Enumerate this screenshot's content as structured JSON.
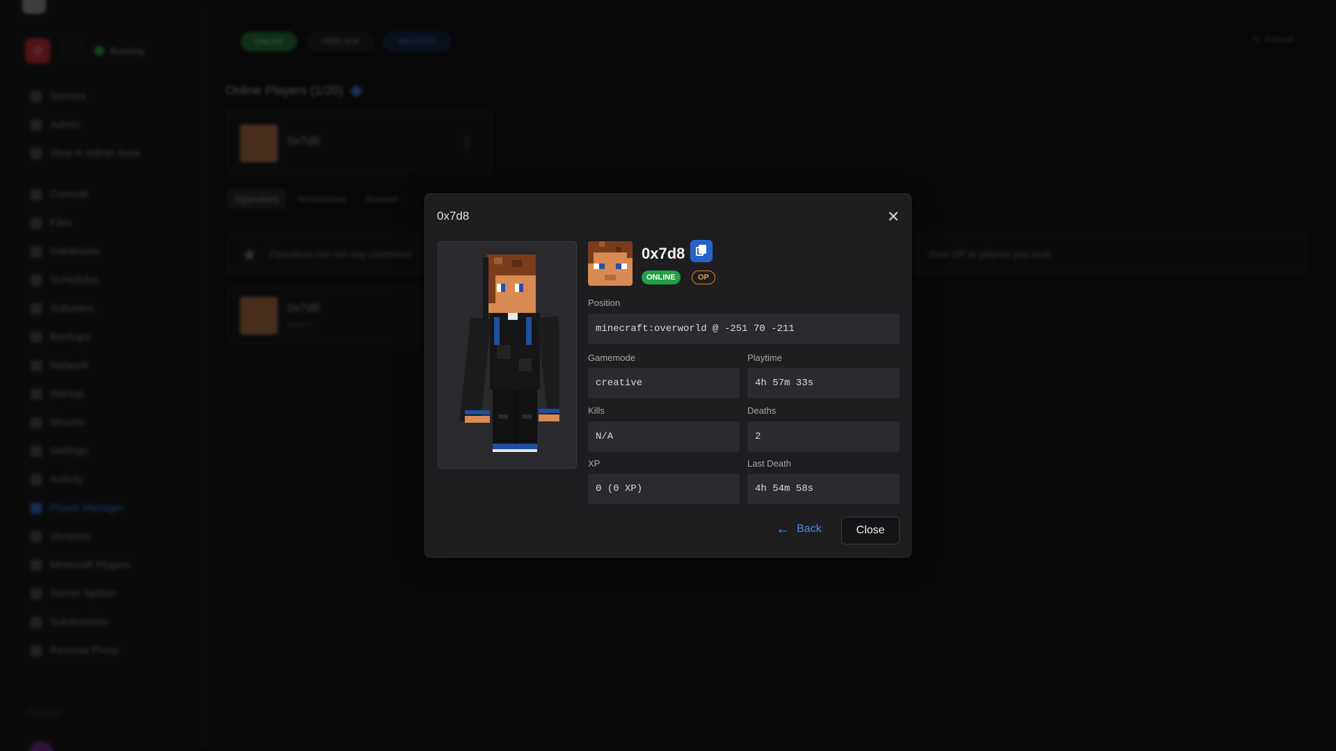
{
  "background": {
    "sidebar": {
      "running_label": "Running",
      "nav": [
        {
          "label": "Servers"
        },
        {
          "label": "Admin"
        },
        {
          "label": "View in Admin Area"
        },
        {
          "label": "Console"
        },
        {
          "label": "Files"
        },
        {
          "label": "Databases"
        },
        {
          "label": "Schedules"
        },
        {
          "label": "Subusers"
        },
        {
          "label": "Backups"
        },
        {
          "label": "Network"
        },
        {
          "label": "Startup"
        },
        {
          "label": "Mounts"
        },
        {
          "label": "Settings"
        },
        {
          "label": "Activity"
        },
        {
          "label": "Player Manager"
        },
        {
          "label": "Versions"
        },
        {
          "label": "Minecraft Plugins"
        },
        {
          "label": "Server Splitter"
        },
        {
          "label": "Subdomains"
        },
        {
          "label": "Reverse Proxy"
        }
      ],
      "footer_label": "Personal"
    },
    "status": {
      "online": "ONLINE",
      "free": "FREE 3GB",
      "version": "VELOCITY"
    },
    "reboot_label": "Reboot",
    "online_players_title": "Online Players (1/20)",
    "player_card_name": "0x7d8",
    "tabs": [
      "Operators",
      "Whitelisted",
      "Banned"
    ],
    "info_left": "Operators can run any command",
    "info_right": "Give OP to players you trust.",
    "op_player_name": "0x7d8",
    "op_player_sub": "Level 4"
  },
  "dialog": {
    "title": "0x7d8",
    "player_name": "0x7d8",
    "badges": {
      "online": "ONLINE",
      "op": "OP"
    },
    "position": {
      "label": "Position",
      "value": "minecraft:overworld @ -251 70 -211"
    },
    "gamemode": {
      "label": "Gamemode",
      "value": "creative"
    },
    "playtime": {
      "label": "Playtime",
      "value": "4h 57m 33s"
    },
    "kills": {
      "label": "Kills",
      "value": "N/A"
    },
    "deaths": {
      "label": "Deaths",
      "value": "2"
    },
    "xp": {
      "label": "XP",
      "value": "0 (0 XP)"
    },
    "last_death": {
      "label": "Last Death",
      "value": "4h 54m 58s"
    },
    "back_label": "Back",
    "close_label": "Close"
  },
  "colors": {
    "accent": "#2563c9",
    "online_badge": "#22a045",
    "op_badge": "#e39a3b",
    "dialog_bg": "#1e1e21"
  }
}
